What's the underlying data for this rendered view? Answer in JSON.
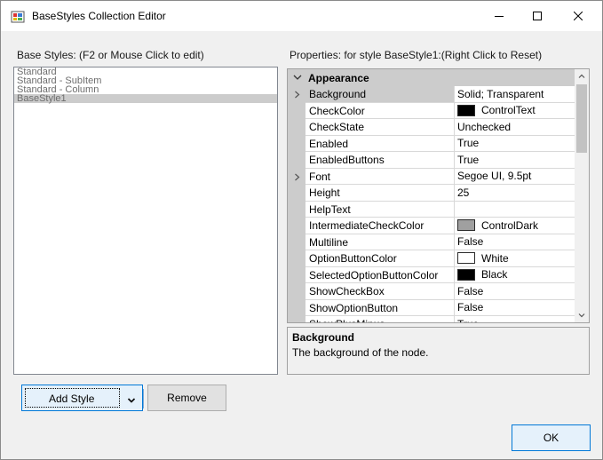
{
  "window": {
    "title": "BaseStyles Collection Editor",
    "minimize_icon": "minimize-icon",
    "maximize_icon": "maximize-icon",
    "close_icon": "close-icon"
  },
  "base_styles": {
    "label": "Base Styles: (F2 or Mouse Click to edit)",
    "items": [
      "Standard",
      "Standard - SubItem",
      "Standard - Column",
      "BaseStyle1"
    ],
    "selected": "BaseStyle1"
  },
  "properties": {
    "label": "Properties: for style BaseStyle1:(Right Click to Reset)",
    "category": "Appearance",
    "rows": [
      {
        "name": "Background",
        "value": "Solid; Transparent",
        "expandable": true,
        "selected": true
      },
      {
        "name": "CheckColor",
        "value": "ControlText",
        "swatch": "#000000"
      },
      {
        "name": "CheckState",
        "value": "Unchecked"
      },
      {
        "name": "Enabled",
        "value": "True"
      },
      {
        "name": "EnabledButtons",
        "value": "True"
      },
      {
        "name": "Font",
        "value": "Segoe UI, 9.5pt",
        "expandable": true
      },
      {
        "name": "Height",
        "value": "25"
      },
      {
        "name": "HelpText",
        "value": ""
      },
      {
        "name": "IntermediateCheckColor",
        "value": "ControlDark",
        "swatch": "#a0a0a0"
      },
      {
        "name": "Multiline",
        "value": "False"
      },
      {
        "name": "OptionButtonColor",
        "value": "White",
        "swatch": "#ffffff"
      },
      {
        "name": "SelectedOptionButtonColor",
        "value": "Black",
        "swatch": "#000000"
      },
      {
        "name": "ShowCheckBox",
        "value": "False"
      },
      {
        "name": "ShowOptionButton",
        "value": "False"
      },
      {
        "name": "ShowPlusMinus",
        "value": "True"
      }
    ]
  },
  "description": {
    "title": "Background",
    "text": "The background of the node."
  },
  "buttons": {
    "add_style": "Add Style",
    "remove": "Remove",
    "ok": "OK"
  },
  "colors": {
    "selection": "#cccccc",
    "button_accent": "#0078d7"
  }
}
